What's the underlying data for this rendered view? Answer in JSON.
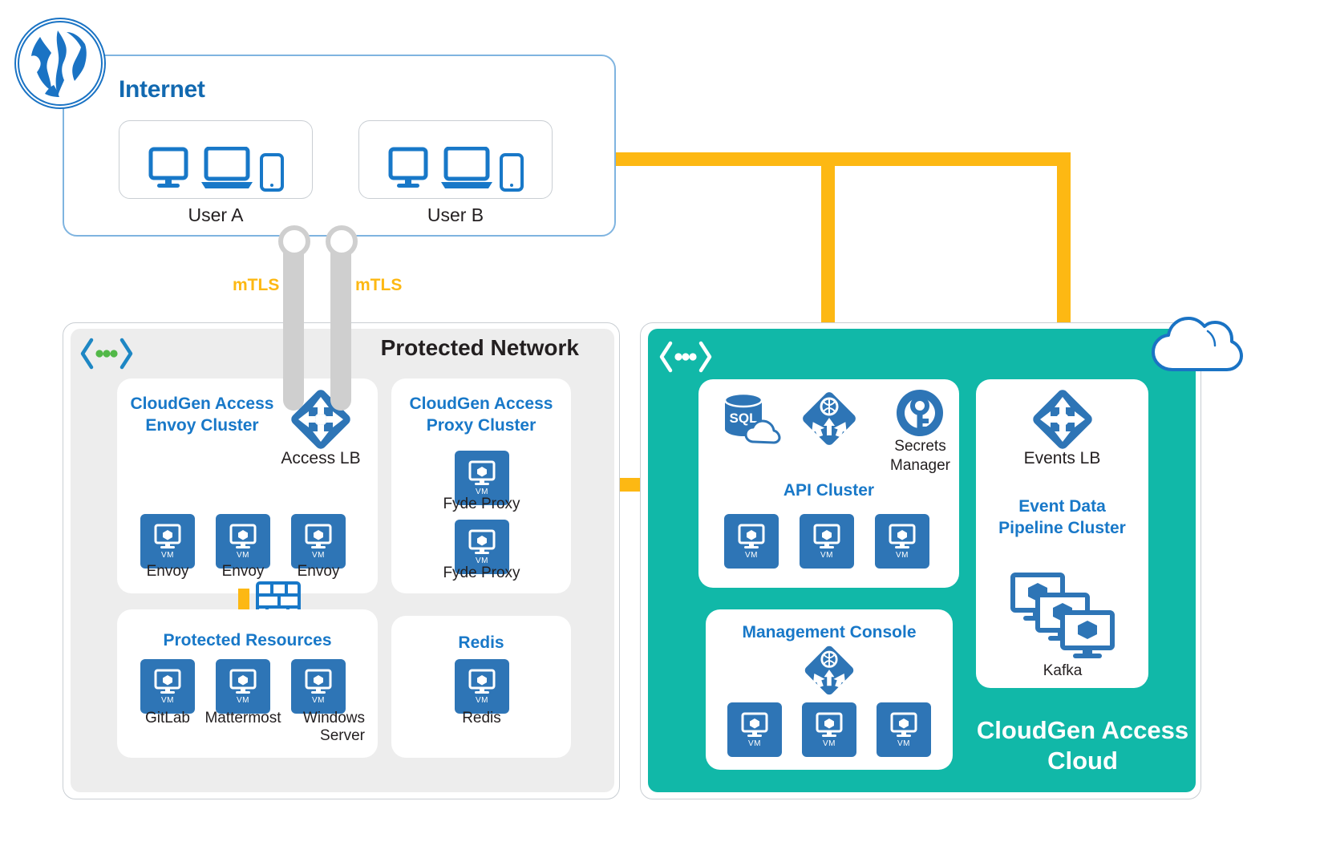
{
  "internet": {
    "label": "Internet",
    "users": [
      {
        "label": "User A",
        "devices": [
          "desktop-monitor",
          "laptop",
          "smartphone"
        ]
      },
      {
        "label": "User B",
        "devices": [
          "desktop-monitor",
          "laptop",
          "smartphone"
        ]
      }
    ]
  },
  "tunnels": [
    {
      "label": "mTLS"
    },
    {
      "label": "mTLS"
    }
  ],
  "protected_network": {
    "title": "Protected Network",
    "status_icon": "code-brackets-dots-icon",
    "envoy_cluster": {
      "title": "CloudGen Access\nEnvoy Cluster",
      "title_line1": "CloudGen Access",
      "title_line2": "Envoy Cluster",
      "load_balancer": {
        "icon": "load-balancer-icon",
        "label": "Access LB"
      },
      "nodes": [
        {
          "label": "Envoy",
          "icon": "vm-icon",
          "badge": "VM"
        },
        {
          "label": "Envoy",
          "icon": "vm-icon",
          "badge": "VM"
        },
        {
          "label": "Envoy",
          "icon": "vm-icon",
          "badge": "VM"
        }
      ]
    },
    "firewall": {
      "icon": "firewall-brick-wall-icon"
    },
    "protected_resources": {
      "title": "Protected Resources",
      "nodes": [
        {
          "label": "GitLab",
          "icon": "vm-icon",
          "badge": "VM"
        },
        {
          "label": "Mattermost",
          "icon": "vm-icon",
          "badge": "VM"
        },
        {
          "label": "Windows\nServer",
          "label_line1": "Windows",
          "label_line2": "Server",
          "icon": "vm-icon",
          "badge": "VM"
        }
      ]
    },
    "proxy_cluster": {
      "title_line1": "CloudGen Access",
      "title_line2": "Proxy Cluster",
      "nodes": [
        {
          "label": "Fyde Proxy",
          "icon": "vm-icon",
          "badge": "VM"
        },
        {
          "label": "Fyde Proxy",
          "icon": "vm-icon",
          "badge": "VM"
        }
      ]
    },
    "redis": {
      "title": "Redis",
      "nodes": [
        {
          "label": "Redis",
          "icon": "vm-icon",
          "badge": "VM"
        }
      ]
    }
  },
  "cloud": {
    "name_line1": "CloudGen Access",
    "name_line2": "Cloud",
    "status_icon": "code-brackets-dots-icon",
    "cloud_icon": "cloud-outline-icon",
    "api_cluster": {
      "title": "API Cluster",
      "top_icons": [
        {
          "name": "sql-database-cloud-icon",
          "label": "SQL"
        },
        {
          "name": "traffic-manager-icon",
          "label": ""
        },
        {
          "name": "secrets-manager-key-icon",
          "label": "Secrets\nManager",
          "label_line1": "Secrets",
          "label_line2": "Manager"
        }
      ],
      "nodes": [
        {
          "label": "",
          "icon": "vm-icon",
          "badge": "VM"
        },
        {
          "label": "",
          "icon": "vm-icon",
          "badge": "VM"
        },
        {
          "label": "",
          "icon": "vm-icon",
          "badge": "VM"
        }
      ]
    },
    "events": {
      "load_balancer": {
        "icon": "load-balancer-icon",
        "label": "Events LB"
      },
      "title_line1": "Event Data",
      "title_line2": "Pipeline Cluster",
      "kafka": {
        "label": "Kafka",
        "icon": "kafka-stacked-servers-icon"
      }
    },
    "management_console": {
      "title": "Management Console",
      "icon": "traffic-manager-icon",
      "nodes": [
        {
          "label": "",
          "icon": "vm-icon",
          "badge": "VM"
        },
        {
          "label": "",
          "icon": "vm-icon",
          "badge": "VM"
        },
        {
          "label": "",
          "icon": "vm-icon",
          "badge": "VM"
        }
      ]
    }
  },
  "colors": {
    "teal": "#11B8A8",
    "orange": "#FDB813",
    "blue": "#1878C8",
    "vm_blue": "#2E75B6",
    "grey_panel": "#EDEDED",
    "tube_grey": "#CFCFCF"
  }
}
